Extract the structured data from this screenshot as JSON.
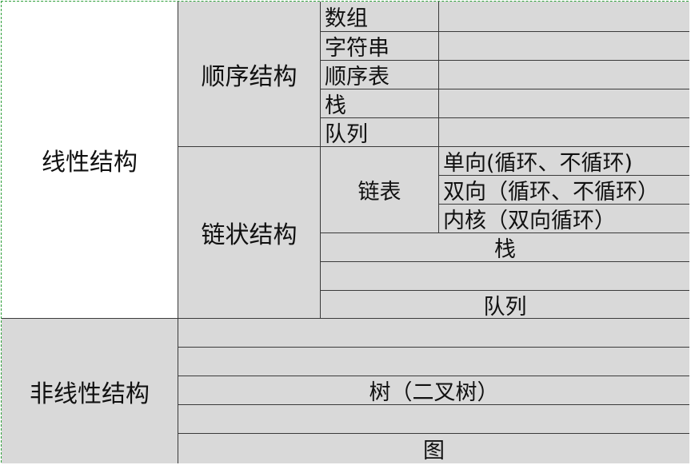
{
  "linear": {
    "label": "线性结构",
    "sequential": {
      "label": "顺序结构",
      "items": [
        "数组",
        "字符串",
        "顺序表",
        "栈",
        "队列"
      ]
    },
    "chained": {
      "label": "链状结构",
      "linked_list": {
        "label": "链表",
        "variants": [
          "单向(循环、不循环)",
          "双向（循环、不循环）",
          "内核（双向循环）"
        ]
      },
      "stack": "栈",
      "queue": "队列"
    }
  },
  "nonlinear": {
    "label": "非线性结构",
    "tree": "树（二叉树）",
    "graph": "图"
  },
  "colors": {
    "cell_fill": "#d9d9d9",
    "grid_line": "#3a3a3a",
    "frame_dash": "#2e9e3a"
  }
}
